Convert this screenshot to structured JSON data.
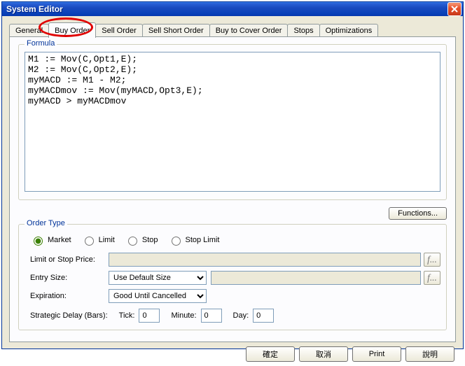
{
  "window": {
    "title": "System Editor"
  },
  "tabs": [
    {
      "label": "General"
    },
    {
      "label": "Buy Order"
    },
    {
      "label": "Sell Order"
    },
    {
      "label": "Sell Short Order"
    },
    {
      "label": "Buy to Cover Order"
    },
    {
      "label": "Stops"
    },
    {
      "label": "Optimizations"
    }
  ],
  "formula": {
    "legend": "Formula",
    "text": "M1 := Mov(C,Opt1,E);\nM2 := Mov(C,Opt2,E);\nmyMACD := M1 - M2;\nmyMACDmov := Mov(myMACD,Opt3,E);\nmyMACD > myMACDmov",
    "functions_btn": "Functions..."
  },
  "order": {
    "legend": "Order Type",
    "radios": {
      "market": "Market",
      "limit": "Limit",
      "stop": "Stop",
      "stop_limit": "Stop Limit"
    },
    "limit_price_label": "Limit or Stop Price:",
    "limit_price_value": "",
    "entry_size_label": "Entry Size:",
    "entry_size_value": "Use Default Size",
    "entry_size_extra": "",
    "expiration_label": "Expiration:",
    "expiration_value": "Good Until Cancelled",
    "delay_label": "Strategic Delay (Bars):",
    "tick_label": "Tick:",
    "tick_value": "0",
    "minute_label": "Minute:",
    "minute_value": "0",
    "day_label": "Day:",
    "day_value": "0",
    "fx_label": "f..."
  },
  "buttons": {
    "ok": "確定",
    "cancel": "取消",
    "print": "Print",
    "help": "說明"
  }
}
